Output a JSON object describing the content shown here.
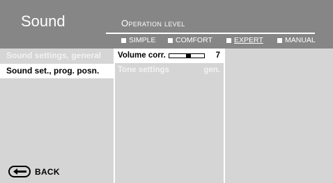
{
  "header": {
    "title": "Sound",
    "operation_level": "Operation level",
    "options": [
      {
        "label": "SIMPLE",
        "selected": false
      },
      {
        "label": "COMFORT",
        "selected": false
      },
      {
        "label": "EXPERT",
        "selected": true
      },
      {
        "label": "MANUAL",
        "selected": false
      }
    ]
  },
  "left_menu": {
    "items": [
      {
        "label": "Sound settings, general",
        "active": false
      },
      {
        "label": "Sound set., prog. posn.",
        "active": true
      }
    ]
  },
  "middle_menu": {
    "items": [
      {
        "label": "Volume corr.",
        "value": "7",
        "active": true,
        "slider_level": 0.55
      },
      {
        "label": "Tone settings",
        "value": "gen.",
        "active": false
      }
    ]
  },
  "footer": {
    "back_label": "BACK",
    "back_icon": "back-arrow-icon"
  },
  "colors": {
    "header_bg": "#868686",
    "panel_bg": "#d5d5d5",
    "highlight": "#ffffff",
    "dim_text": "#f2f2f2"
  }
}
